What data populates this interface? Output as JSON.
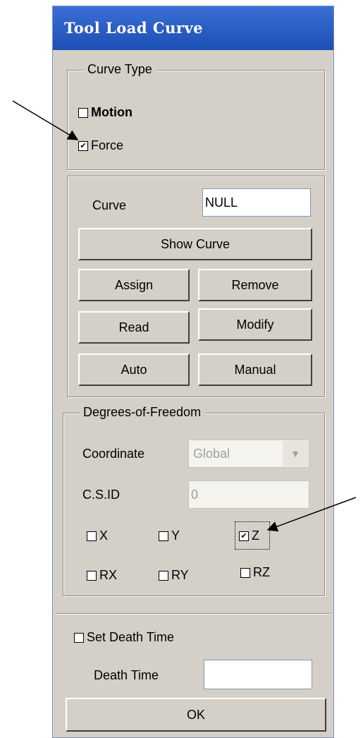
{
  "window": {
    "title": "Tool Load Curve"
  },
  "curve_type": {
    "legend": "Curve Type",
    "motion": {
      "label": "Motion",
      "checked": false
    },
    "force": {
      "label": "Force",
      "checked": true
    }
  },
  "curve": {
    "label": "Curve",
    "value": "NULL",
    "buttons": {
      "show_curve": "Show Curve",
      "assign": "Assign",
      "remove": "Remove",
      "read": "Read",
      "modify": "Modify",
      "auto": "Auto",
      "manual": "Manual"
    }
  },
  "dof": {
    "legend": "Degrees-of-Freedom",
    "coordinate_label": "Coordinate",
    "coordinate_value": "Global",
    "csid_label": "C.S.ID",
    "csid_value": "0",
    "x": {
      "label": "X",
      "checked": false
    },
    "y": {
      "label": "Y",
      "checked": false
    },
    "z": {
      "label": "Z",
      "checked": true
    },
    "rx": {
      "label": "RX",
      "checked": false
    },
    "ry": {
      "label": "RY",
      "checked": false
    },
    "rz": {
      "label": "RZ",
      "checked": false
    }
  },
  "death": {
    "set_label": "Set Death Time",
    "set_checked": false,
    "time_label": "Death Time",
    "time_value": ""
  },
  "ok_label": "OK",
  "check_glyph": "✔"
}
